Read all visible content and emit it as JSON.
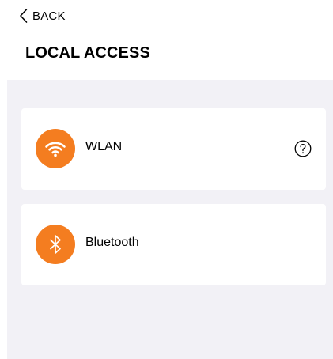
{
  "header": {
    "back_label": "BACK",
    "back_icon": "chevron-left-icon",
    "title": "LOCAL ACCESS"
  },
  "options": [
    {
      "label": "WLAN",
      "icon": "wifi-icon",
      "help_icon": "question-circle-icon"
    },
    {
      "label": "Bluetooth",
      "icon": "bluetooth-icon"
    }
  ],
  "colors": {
    "accent": "#f47d20",
    "background_panel": "#f2f1f6",
    "card": "#ffffff",
    "text": "#000000"
  }
}
